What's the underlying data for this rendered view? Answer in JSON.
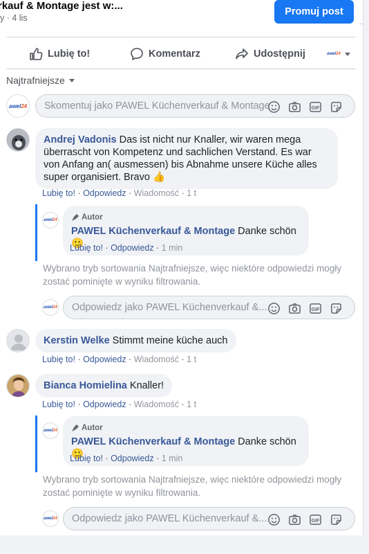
{
  "post": {
    "title": "rkauf & Montage jest w:...",
    "subtitle": "y · 4 lis",
    "promote_label": "Promuj post"
  },
  "actions": {
    "like": "Lubię to!",
    "comment": "Komentarz",
    "share": "Udostępnij"
  },
  "sort_label": "Najtrafniejsze",
  "page_logo_text": [
    "awel",
    "24"
  ],
  "main_input_placeholder": "Skomentuj jako PAWEL Küchenverkauf & Montage",
  "reply_input_placeholder": "Odpowiedz jako PAWEL Küchenverkauf &...",
  "comment_meta": {
    "like": "Lubię to!",
    "reply": "Odpowiedz",
    "message": "Wiadomość",
    "time": "1 t"
  },
  "reply_meta": {
    "like": "Lubię to!",
    "reply": "Odpowiedz",
    "time": "1 min"
  },
  "author_badge": "Autor",
  "filter_notice": "Wybrano tryb sortowania Najtrafniejsze, więc niektóre odpowiedzi mogły zostać pominięte w wyniku filtrowania.",
  "comments": [
    {
      "name": "Andrej Vadonis",
      "text": "Das ist nicht nur Knaller, wir waren mega überrascht von Kompetenz und sachlichen Verstand. Es war von Anfang an( ausmessen) bis Abnahme unsere Küche alles super organisiert. Bravo",
      "emoji": "👍",
      "reply": {
        "name": "PAWEL Küchenverkauf & Montage",
        "text": "Danke schön",
        "emoji": "🙂"
      }
    },
    {
      "name": "Kerstin Welke",
      "text": "Stimmt meine küche auch"
    },
    {
      "name": "Bianca Homielina",
      "text": "Knaller!",
      "reply": {
        "name": "PAWEL Küchenverkauf & Montage",
        "text": "Danke schön",
        "emoji": "🙂"
      }
    }
  ],
  "colors": {
    "accent": "#1877f2",
    "link": "#385898",
    "muted": "#90949c"
  }
}
